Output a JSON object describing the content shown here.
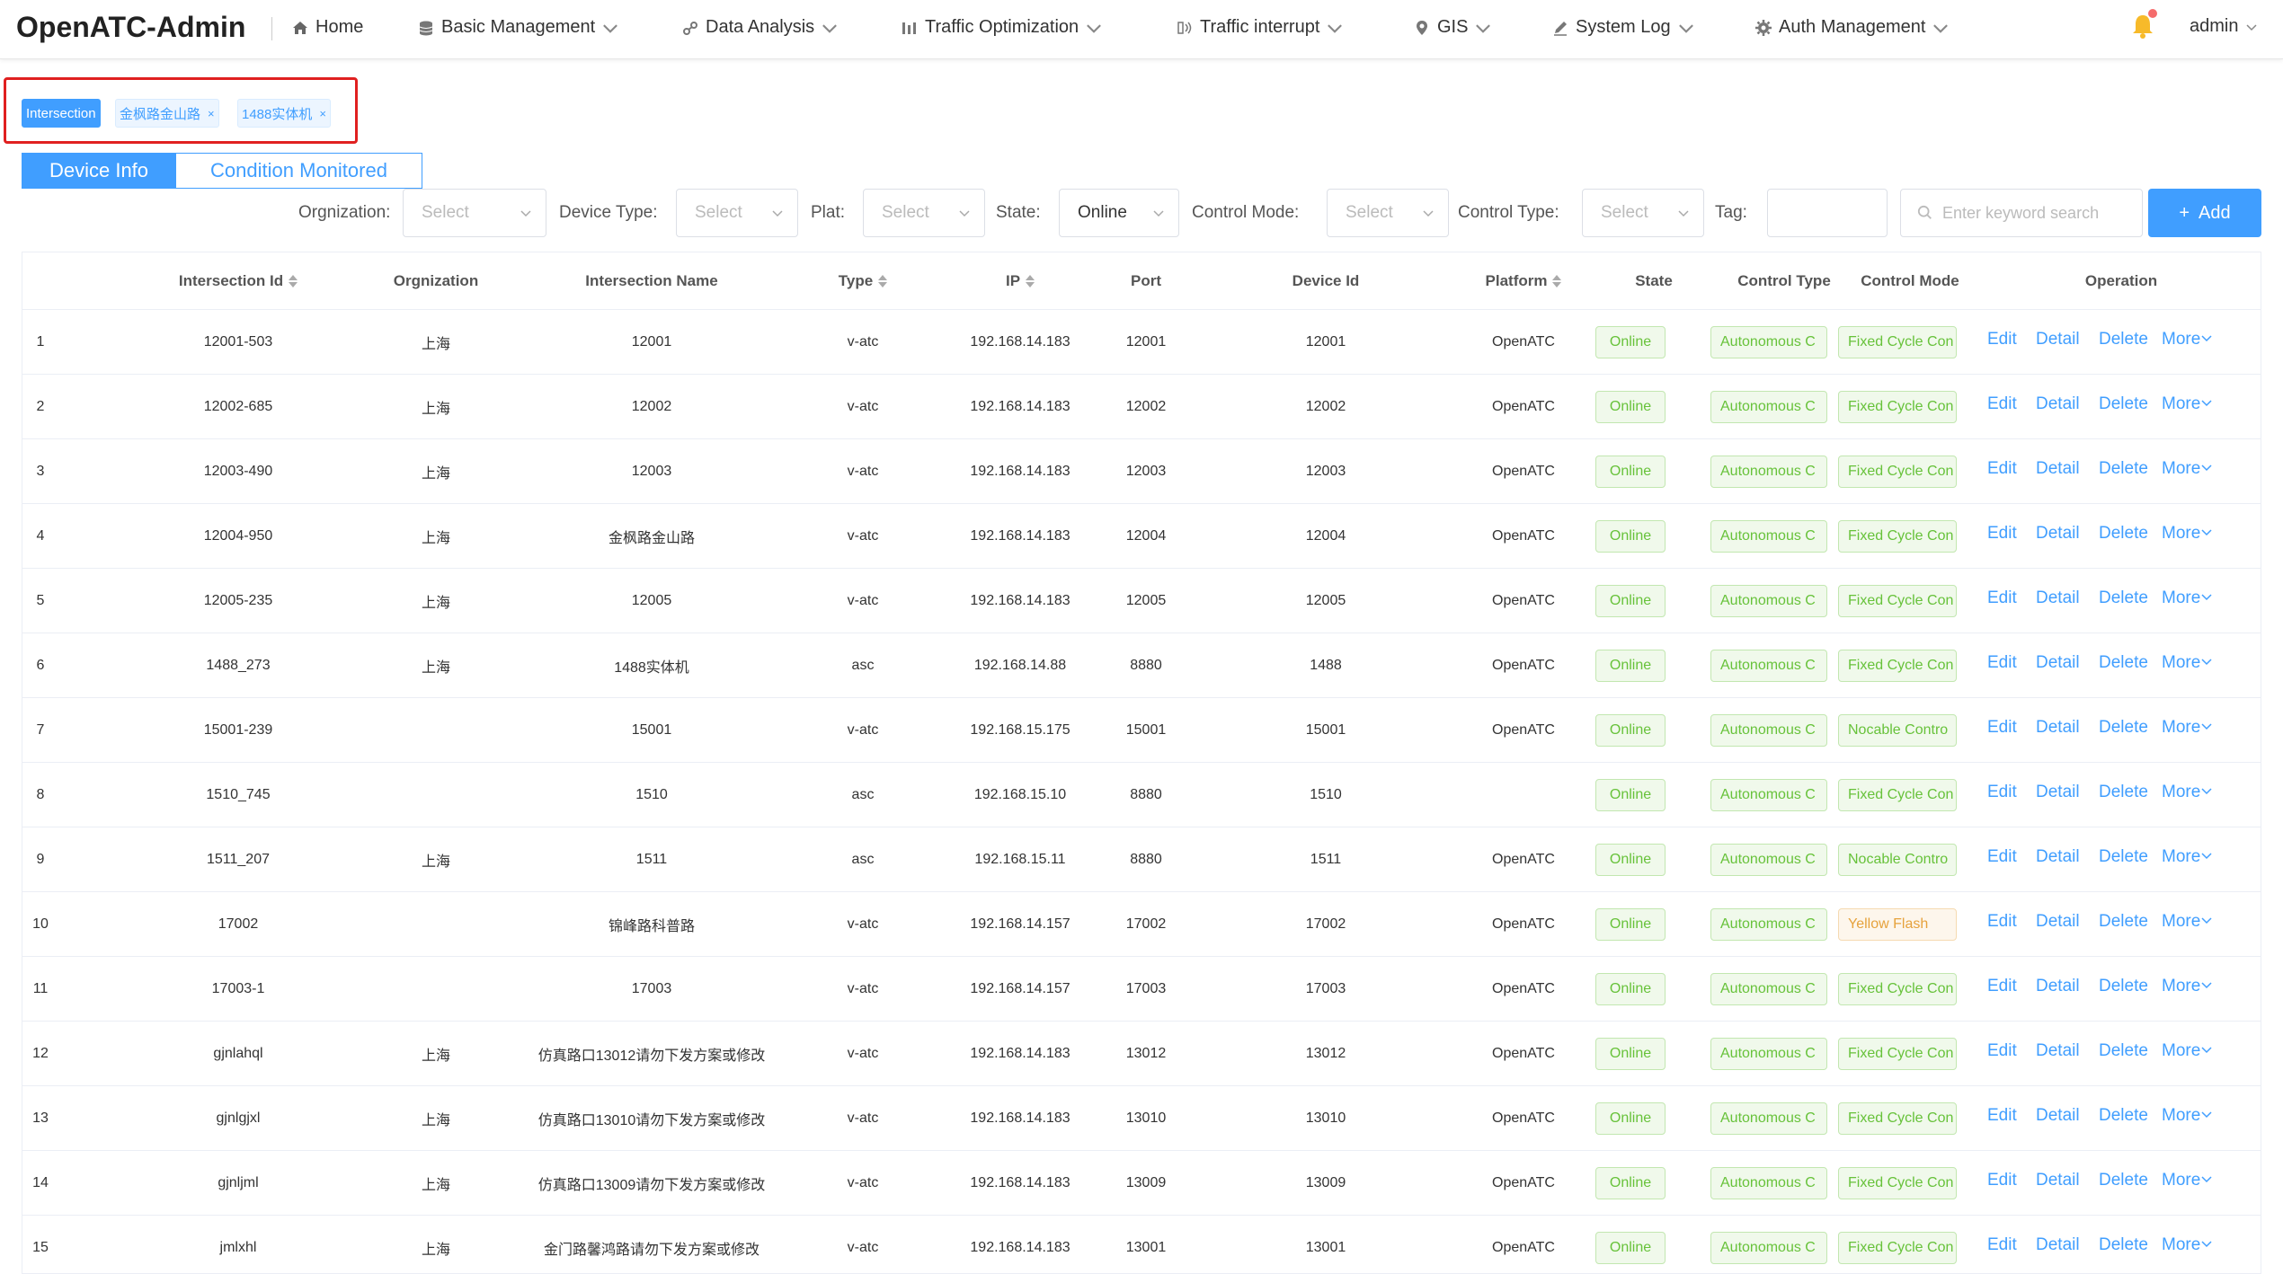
{
  "app": {
    "title": "OpenATC-Admin"
  },
  "nav": {
    "home": "Home",
    "basic": "Basic Management",
    "data": "Data Analysis",
    "traffic": "Traffic Optimization",
    "interrupt": "Traffic interrupt",
    "gis": "GIS",
    "log": "System Log",
    "auth": "Auth Management",
    "user": "admin"
  },
  "tags": {
    "active": "Intersection",
    "t1": "金枫路金山路",
    "t2": "1488实体机"
  },
  "tabs": {
    "device": "Device Info",
    "condition": "Condition Monitored"
  },
  "filters": {
    "org_label": "Orgnization:",
    "org_val": "Select",
    "dtype_label": "Device Type:",
    "dtype_val": "Select",
    "plat_label": "Plat:",
    "plat_val": "Select",
    "state_label": "State:",
    "state_val": "Online",
    "cmode_label": "Control Mode:",
    "cmode_val": "Select",
    "ctype_label": "Control Type:",
    "ctype_val": "Select",
    "tag_label": "Tag:",
    "search_placeholder": "Enter keyword search",
    "add": "Add"
  },
  "table": {
    "headers": {
      "id": "Intersection Id",
      "org": "Orgnization",
      "name": "Intersection Name",
      "type": "Type",
      "ip": "IP",
      "port": "Port",
      "device": "Device Id",
      "platform": "Platform",
      "state": "State",
      "ctype": "Control Type",
      "cmode": "Control Mode",
      "op": "Operation"
    },
    "ops": {
      "edit": "Edit",
      "detail": "Detail",
      "delete": "Delete",
      "more": "More"
    },
    "rows": [
      {
        "n": "1",
        "id": "12001-503",
        "org": "上海",
        "name": "12001",
        "type": "v-atc",
        "ip": "192.168.14.183",
        "port": "12001",
        "device": "12001",
        "platform": "OpenATC",
        "state": "Online",
        "ctype": "Autonomous C",
        "cmode": "Fixed Cycle Con"
      },
      {
        "n": "2",
        "id": "12002-685",
        "org": "上海",
        "name": "12002",
        "type": "v-atc",
        "ip": "192.168.14.183",
        "port": "12002",
        "device": "12002",
        "platform": "OpenATC",
        "state": "Online",
        "ctype": "Autonomous C",
        "cmode": "Fixed Cycle Con"
      },
      {
        "n": "3",
        "id": "12003-490",
        "org": "上海",
        "name": "12003",
        "type": "v-atc",
        "ip": "192.168.14.183",
        "port": "12003",
        "device": "12003",
        "platform": "OpenATC",
        "state": "Online",
        "ctype": "Autonomous C",
        "cmode": "Fixed Cycle Con"
      },
      {
        "n": "4",
        "id": "12004-950",
        "org": "上海",
        "name": "金枫路金山路",
        "type": "v-atc",
        "ip": "192.168.14.183",
        "port": "12004",
        "device": "12004",
        "platform": "OpenATC",
        "state": "Online",
        "ctype": "Autonomous C",
        "cmode": "Fixed Cycle Con"
      },
      {
        "n": "5",
        "id": "12005-235",
        "org": "上海",
        "name": "12005",
        "type": "v-atc",
        "ip": "192.168.14.183",
        "port": "12005",
        "device": "12005",
        "platform": "OpenATC",
        "state": "Online",
        "ctype": "Autonomous C",
        "cmode": "Fixed Cycle Con"
      },
      {
        "n": "6",
        "id": "1488_273",
        "org": "上海",
        "name": "1488实体机",
        "type": "asc",
        "ip": "192.168.14.88",
        "port": "8880",
        "device": "1488",
        "platform": "OpenATC",
        "state": "Online",
        "ctype": "Autonomous C",
        "cmode": "Fixed Cycle Con"
      },
      {
        "n": "7",
        "id": "15001-239",
        "org": "",
        "name": "15001",
        "type": "v-atc",
        "ip": "192.168.15.175",
        "port": "15001",
        "device": "15001",
        "platform": "OpenATC",
        "state": "Online",
        "ctype": "Autonomous C",
        "cmode": "Nocable Contro"
      },
      {
        "n": "8",
        "id": "1510_745",
        "org": "",
        "name": "1510",
        "type": "asc",
        "ip": "192.168.15.10",
        "port": "8880",
        "device": "1510",
        "platform": "",
        "state": "Online",
        "ctype": "Autonomous C",
        "cmode": "Fixed Cycle Con"
      },
      {
        "n": "9",
        "id": "1511_207",
        "org": "上海",
        "name": "1511",
        "type": "asc",
        "ip": "192.168.15.11",
        "port": "8880",
        "device": "1511",
        "platform": "OpenATC",
        "state": "Online",
        "ctype": "Autonomous C",
        "cmode": "Nocable Contro"
      },
      {
        "n": "10",
        "id": "17002",
        "org": "",
        "name": "锦峰路科普路",
        "type": "v-atc",
        "ip": "192.168.14.157",
        "port": "17002",
        "device": "17002",
        "platform": "OpenATC",
        "state": "Online",
        "ctype": "Autonomous C",
        "cmode": "Yellow Flash",
        "warn": true
      },
      {
        "n": "11",
        "id": "17003-1",
        "org": "",
        "name": "17003",
        "type": "v-atc",
        "ip": "192.168.14.157",
        "port": "17003",
        "device": "17003",
        "platform": "OpenATC",
        "state": "Online",
        "ctype": "Autonomous C",
        "cmode": "Fixed Cycle Con"
      },
      {
        "n": "12",
        "id": "gjnlahql",
        "org": "上海",
        "name": "仿真路口13012请勿下发方案或修改",
        "type": "v-atc",
        "ip": "192.168.14.183",
        "port": "13012",
        "device": "13012",
        "platform": "OpenATC",
        "state": "Online",
        "ctype": "Autonomous C",
        "cmode": "Fixed Cycle Con"
      },
      {
        "n": "13",
        "id": "gjnlgjxl",
        "org": "上海",
        "name": "仿真路口13010请勿下发方案或修改",
        "type": "v-atc",
        "ip": "192.168.14.183",
        "port": "13010",
        "device": "13010",
        "platform": "OpenATC",
        "state": "Online",
        "ctype": "Autonomous C",
        "cmode": "Fixed Cycle Con"
      },
      {
        "n": "14",
        "id": "gjnljml",
        "org": "上海",
        "name": "仿真路口13009请勿下发方案或修改",
        "type": "v-atc",
        "ip": "192.168.14.183",
        "port": "13009",
        "device": "13009",
        "platform": "OpenATC",
        "state": "Online",
        "ctype": "Autonomous C",
        "cmode": "Fixed Cycle Con"
      },
      {
        "n": "15",
        "id": "jmlxhl",
        "org": "上海",
        "name": "金门路馨鸿路请勿下发方案或修改",
        "type": "v-atc",
        "ip": "192.168.14.183",
        "port": "13001",
        "device": "13001",
        "platform": "OpenATC",
        "state": "Online",
        "ctype": "Autonomous C",
        "cmode": "Fixed Cycle Con"
      }
    ]
  }
}
